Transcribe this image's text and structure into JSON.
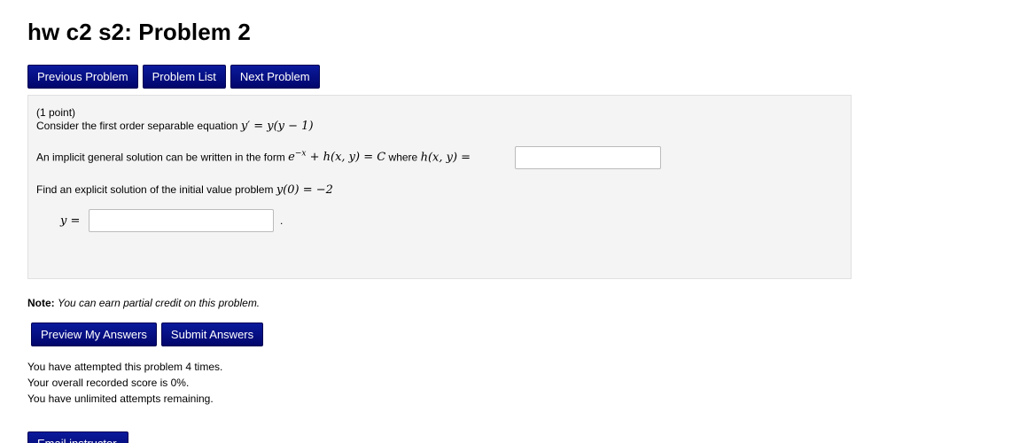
{
  "title": "hw c2 s2: Problem 2",
  "nav": {
    "previous": "Previous Problem",
    "list": "Problem List",
    "next": "Next Problem"
  },
  "problem": {
    "points": "(1 point)",
    "intro": "Consider the first order separable equation",
    "equation": "y′ = y(y − 1)",
    "implicit_prefix": "An implicit general solution can be written in the form",
    "implicit_form": "e^{-x} + h(x, y) = C",
    "implicit_where": "where",
    "h_label": "h(x, y) =",
    "h_value": "",
    "explicit_prefix": "Find an explicit solution of the initial value problem",
    "initial_condition": "y(0) = −2",
    "y_label": "y =",
    "y_value": "",
    "period": "."
  },
  "note": {
    "label": "Note:",
    "text": "You can earn partial credit on this problem."
  },
  "actions": {
    "preview": "Preview My Answers",
    "submit": "Submit Answers"
  },
  "status": {
    "attempts": "You have attempted this problem 4 times.",
    "score": "Your overall recorded score is 0%.",
    "remaining": "You have unlimited attempts remaining."
  },
  "email_button": "Email instructor",
  "colors": {
    "button": "#04077f",
    "box_background": "#f4f4f4"
  }
}
